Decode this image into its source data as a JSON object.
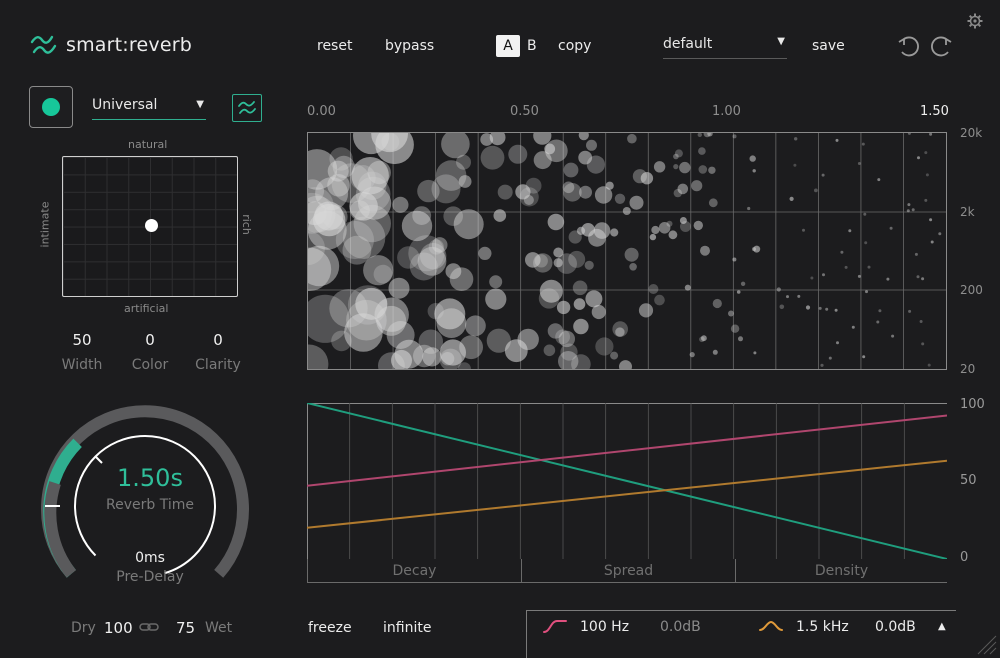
{
  "header": {
    "app_name": "smart:reverb",
    "reset_label": "reset",
    "bypass_label": "bypass",
    "ab_a": "A",
    "ab_b": "B",
    "copy_label": "copy",
    "preset_value": "default",
    "save_label": "save",
    "icons": [
      "logo-icon",
      "settings-gear-icon",
      "undo-icon",
      "redo-icon",
      "dropdown-arrow-icon"
    ]
  },
  "profile": {
    "value": "Universal",
    "icons": [
      "power-dot-icon",
      "profile-waves-icon"
    ]
  },
  "character_pad": {
    "top": "natural",
    "bottom": "artificial",
    "left": "intimate",
    "right": "rich",
    "position": {
      "natural_to_artificial": 0.5,
      "intimate_to_rich": 0.5
    }
  },
  "params": [
    {
      "value": "50",
      "label": "Width"
    },
    {
      "value": "0",
      "label": "Color"
    },
    {
      "value": "0",
      "label": "Clarity"
    }
  ],
  "reverb_knob": {
    "time_value": "1.50s",
    "time_label": "Reverb Time",
    "predelay_value": "0ms",
    "predelay_label": "Pre-Delay",
    "accent_color": "#2fae8f"
  },
  "mix": {
    "dry_label": "Dry",
    "dry_value": "100",
    "wet_value": "75",
    "wet_label": "Wet",
    "link_icon": "link-icon"
  },
  "scatter_plot": {
    "time_ticks": [
      "0.00",
      "0.50",
      "1.00",
      "1.50"
    ],
    "freq_ticks": [
      "20k",
      "2k",
      "200",
      "20"
    ]
  },
  "chart_data": {
    "type": "line",
    "x": [
      0,
      1
    ],
    "series": [
      {
        "values": [
          100,
          0
        ],
        "color": "#1f9e7e"
      },
      {
        "values": [
          47,
          92
        ],
        "color": "#b0466e"
      },
      {
        "values": [
          20,
          63
        ],
        "color": "#b07a2e"
      }
    ],
    "yticks": [
      "100",
      "50",
      "0"
    ],
    "ylim": [
      0,
      100
    ],
    "categories": [
      "Decay",
      "Spread",
      "Density"
    ],
    "grid": true
  },
  "bottom": {
    "freeze_label": "freeze",
    "infinite_label": "infinite",
    "eq": [
      {
        "icon": "highpass-curve-icon",
        "color": "#e0507e",
        "freq": "100 Hz",
        "gain": "0.0dB"
      },
      {
        "icon": "bell-curve-icon",
        "color": "#e09a3a",
        "freq": "1.5 kHz",
        "gain": "0.0dB"
      }
    ],
    "expand_icon": "triangle-up-icon",
    "resize_icon": "resize-grip-icon"
  }
}
